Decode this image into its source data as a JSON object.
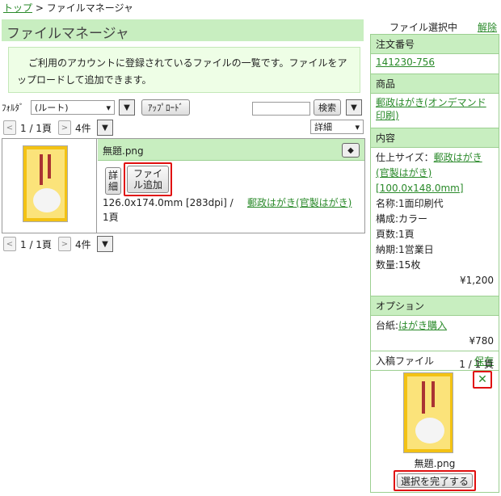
{
  "breadcrumb": {
    "top": "トップ",
    "sep": ">",
    "current": "ファイルマネージャ"
  },
  "page_title": "ファイルマネージャ",
  "notice": "ご利用のアカウントに登録されているファイルの一覧です。ファイルをアップロードして追加できます。",
  "toolbar": {
    "folder_label": "ﾌｫﾙﾀﾞ",
    "folder_value": "(ルート)",
    "upload": "ｱｯﾌﾟﾛｰﾄﾞ",
    "search_placeholder": "",
    "search": "検索",
    "view_mode": "詳細"
  },
  "pager": {
    "page": "1 / 1頁",
    "count": "4件"
  },
  "file": {
    "name": "無題.png",
    "detail": "詳細",
    "add_file": "ファイル追加",
    "info": "126.0x174.0mm [283dpi] / 1頁",
    "link": "郵政はがき(官製はがき)"
  },
  "right": {
    "header": "ファイル選択中",
    "cancel": "解除",
    "order_label": "注文番号",
    "order_no": "141230-756",
    "product_label": "商品",
    "product": "郵政はがき(オンデマンド印刷)",
    "content_label": "内容",
    "finish_label": "仕上サイズ：",
    "finish_link": "郵政はがき(官製はがき)",
    "finish_size": "[100.0x148.0mm]",
    "name_line": "名称:1面印刷代",
    "color_line": "構成:カラー",
    "pages_line": "頁数:1頁",
    "delivery_line": "納期:1営業日",
    "qty_line": "数量:15枚",
    "price1": "¥1,200",
    "option_label": "オプション",
    "mount_label": "台紙:",
    "mount_link": "はがき購入",
    "price2": "¥780",
    "upload_label": "入稿ファイル",
    "save": "保存",
    "upload_pages": "1 / 1 頁",
    "thumb_name": "無題.png",
    "complete": "選択を完了する"
  },
  "colors": {
    "accent_green": "#c8eec0",
    "link_green": "#2a8a2a",
    "highlight_red": "#e01010"
  }
}
